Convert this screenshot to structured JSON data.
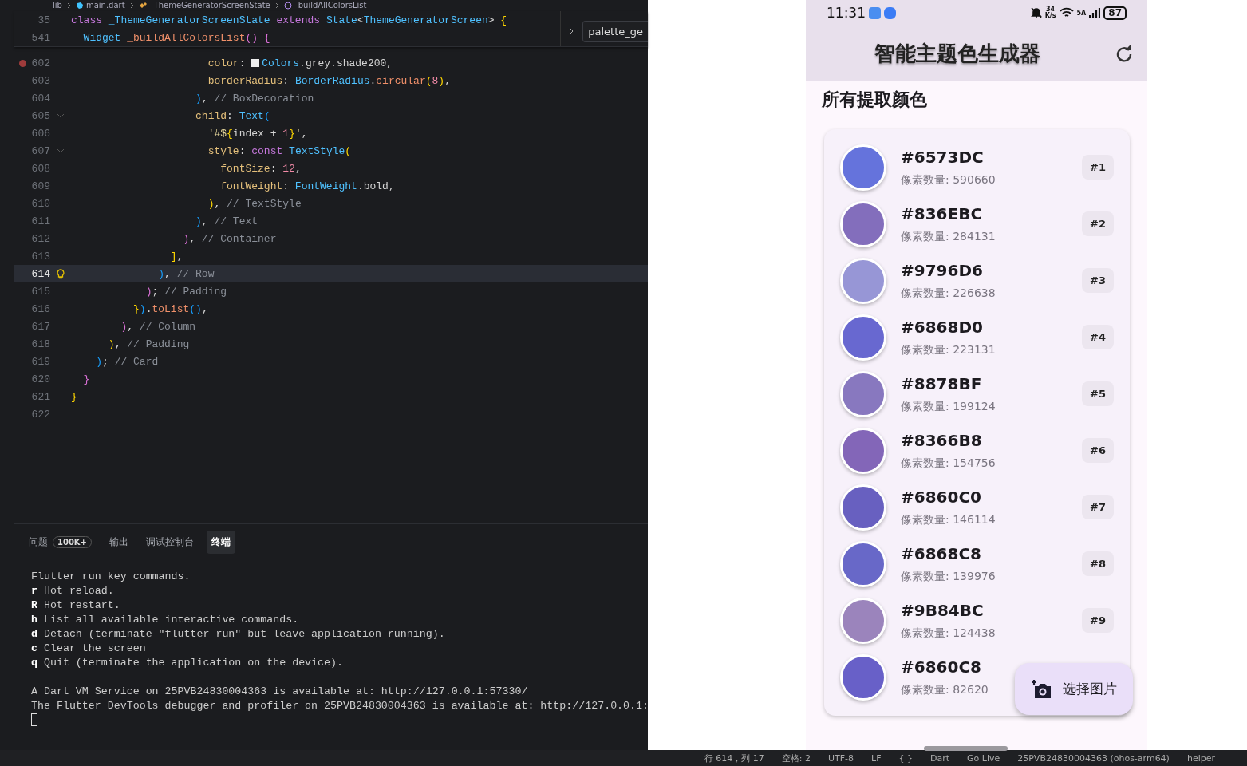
{
  "editor": {
    "breadcrumbs": [
      {
        "label": "lib",
        "kind": "folder"
      },
      {
        "label": "main.dart",
        "kind": "file"
      },
      {
        "label": "_ThemeGeneratorScreenState",
        "kind": "class"
      },
      {
        "label": "_buildAllColorsList",
        "kind": "method"
      }
    ],
    "side_tab": {
      "label": "palette_ge"
    },
    "sticky_lines": [
      {
        "number": "35",
        "tokens": [
          {
            "kind": "keyword",
            "text": "class "
          },
          {
            "kind": "type",
            "text": "_ThemeGeneratorScreenState "
          },
          {
            "kind": "keyword",
            "text": "extends "
          },
          {
            "kind": "type",
            "text": "State"
          },
          {
            "kind": "plain",
            "text": "<"
          },
          {
            "kind": "type",
            "text": "ThemeGeneratorScreen"
          },
          {
            "kind": "plain",
            "text": "> "
          },
          {
            "kind": "bracket1",
            "text": "{"
          }
        ]
      },
      {
        "number": "541",
        "tokens": [
          {
            "kind": "type",
            "text": "  Widget "
          },
          {
            "kind": "function",
            "text": "_buildAllColorsList"
          },
          {
            "kind": "bracket2",
            "text": "() {"
          }
        ]
      }
    ],
    "lines": [
      {
        "number": "602",
        "kind": "breakpoint",
        "current": false,
        "tokens": [
          {
            "kind": "property",
            "text": "                      color"
          },
          {
            "kind": "plain",
            "text": ": "
          },
          {
            "kind": "swatch",
            "color": "#eeeeee"
          },
          {
            "kind": "type",
            "text": "Colors"
          },
          {
            "kind": "plain",
            "text": ".grey.shade200,"
          }
        ]
      },
      {
        "number": "603",
        "kind": "plain",
        "current": false,
        "tokens": [
          {
            "kind": "property",
            "text": "                      borderRadius"
          },
          {
            "kind": "plain",
            "text": ": "
          },
          {
            "kind": "type",
            "text": "BorderRadius"
          },
          {
            "kind": "plain",
            "text": "."
          },
          {
            "kind": "function",
            "text": "circular"
          },
          {
            "kind": "bracket1",
            "text": "("
          },
          {
            "kind": "number",
            "text": "8"
          },
          {
            "kind": "bracket1",
            "text": ")"
          },
          {
            "kind": "plain",
            "text": ","
          }
        ]
      },
      {
        "number": "604",
        "kind": "plain",
        "current": false,
        "tokens": [
          {
            "kind": "bracket3",
            "text": "                    )"
          },
          {
            "kind": "plain",
            "text": ", "
          },
          {
            "kind": "comment",
            "text": "// BoxDecoration"
          }
        ]
      },
      {
        "number": "605",
        "kind": "fold",
        "current": false,
        "tokens": [
          {
            "kind": "property",
            "text": "                    child"
          },
          {
            "kind": "plain",
            "text": ": "
          },
          {
            "kind": "type",
            "text": "Text"
          },
          {
            "kind": "bracket3",
            "text": "("
          }
        ]
      },
      {
        "number": "606",
        "kind": "plain",
        "current": false,
        "tokens": [
          {
            "kind": "string",
            "text": "                      '#$"
          },
          {
            "kind": "bracket1",
            "text": "{"
          },
          {
            "kind": "plain",
            "text": "index + "
          },
          {
            "kind": "number",
            "text": "1"
          },
          {
            "kind": "bracket1",
            "text": "}"
          },
          {
            "kind": "string",
            "text": "'"
          },
          {
            "kind": "plain",
            "text": ","
          }
        ]
      },
      {
        "number": "607",
        "kind": "fold",
        "current": false,
        "tokens": [
          {
            "kind": "property",
            "text": "                      style"
          },
          {
            "kind": "plain",
            "text": ": "
          },
          {
            "kind": "keyword",
            "text": "const "
          },
          {
            "kind": "type",
            "text": "TextStyle"
          },
          {
            "kind": "bracket1",
            "text": "("
          }
        ]
      },
      {
        "number": "608",
        "kind": "plain",
        "current": false,
        "tokens": [
          {
            "kind": "property",
            "text": "                        fontSize"
          },
          {
            "kind": "plain",
            "text": ": "
          },
          {
            "kind": "number",
            "text": "12"
          },
          {
            "kind": "plain",
            "text": ","
          }
        ]
      },
      {
        "number": "609",
        "kind": "plain",
        "current": false,
        "tokens": [
          {
            "kind": "property",
            "text": "                        fontWeight"
          },
          {
            "kind": "plain",
            "text": ": "
          },
          {
            "kind": "type",
            "text": "FontWeight"
          },
          {
            "kind": "plain",
            "text": ".bold,"
          }
        ]
      },
      {
        "number": "610",
        "kind": "plain",
        "current": false,
        "tokens": [
          {
            "kind": "bracket1",
            "text": "                      )"
          },
          {
            "kind": "plain",
            "text": ", "
          },
          {
            "kind": "comment",
            "text": "// TextStyle"
          }
        ]
      },
      {
        "number": "611",
        "kind": "plain",
        "current": false,
        "tokens": [
          {
            "kind": "bracket3",
            "text": "                    )"
          },
          {
            "kind": "plain",
            "text": ", "
          },
          {
            "kind": "comment",
            "text": "// Text"
          }
        ]
      },
      {
        "number": "612",
        "kind": "plain",
        "current": false,
        "tokens": [
          {
            "kind": "bracket2",
            "text": "                  )"
          },
          {
            "kind": "plain",
            "text": ", "
          },
          {
            "kind": "comment",
            "text": "// Container"
          }
        ]
      },
      {
        "number": "613",
        "kind": "plain",
        "current": false,
        "tokens": [
          {
            "kind": "bracket1",
            "text": "                ]"
          },
          {
            "kind": "plain",
            "text": ","
          }
        ]
      },
      {
        "number": "614",
        "kind": "bulb",
        "current": true,
        "tokens": [
          {
            "kind": "bracket3",
            "text": "              )"
          },
          {
            "kind": "plain",
            "text": ", "
          },
          {
            "kind": "comment",
            "text": "// Row"
          }
        ]
      },
      {
        "number": "615",
        "kind": "plain",
        "current": false,
        "tokens": [
          {
            "kind": "bracket2",
            "text": "            )"
          },
          {
            "kind": "plain",
            "text": "; "
          },
          {
            "kind": "comment",
            "text": "// Padding"
          }
        ]
      },
      {
        "number": "616",
        "kind": "plain",
        "current": false,
        "tokens": [
          {
            "kind": "bracket1",
            "text": "          }"
          },
          {
            "kind": "bracket3",
            "text": ")"
          },
          {
            "kind": "plain",
            "text": "."
          },
          {
            "kind": "function",
            "text": "toList"
          },
          {
            "kind": "bracket3",
            "text": "()"
          },
          {
            "kind": "plain",
            "text": ","
          }
        ]
      },
      {
        "number": "617",
        "kind": "plain",
        "current": false,
        "tokens": [
          {
            "kind": "bracket2",
            "text": "        )"
          },
          {
            "kind": "plain",
            "text": ", "
          },
          {
            "kind": "comment",
            "text": "// Column"
          }
        ]
      },
      {
        "number": "618",
        "kind": "plain",
        "current": false,
        "tokens": [
          {
            "kind": "bracket1",
            "text": "      )"
          },
          {
            "kind": "plain",
            "text": ", "
          },
          {
            "kind": "comment",
            "text": "// Padding"
          }
        ]
      },
      {
        "number": "619",
        "kind": "plain",
        "current": false,
        "tokens": [
          {
            "kind": "bracket3",
            "text": "    )"
          },
          {
            "kind": "plain",
            "text": "; "
          },
          {
            "kind": "comment",
            "text": "// Card"
          }
        ]
      },
      {
        "number": "620",
        "kind": "plain",
        "current": false,
        "tokens": [
          {
            "kind": "bracket2",
            "text": "  }"
          }
        ]
      },
      {
        "number": "621",
        "kind": "plain",
        "current": false,
        "tokens": [
          {
            "kind": "bracket1",
            "text": "}"
          }
        ]
      },
      {
        "number": "622",
        "kind": "plain",
        "current": false
      }
    ]
  },
  "panel": {
    "tabs": [
      {
        "label": "问题",
        "badge": "100K+",
        "selected": false
      },
      {
        "label": "输出",
        "selected": false
      },
      {
        "label": "调试控制台",
        "selected": false
      },
      {
        "label": "终端",
        "selected": true
      }
    ],
    "terminal_blocks": [
      [
        "Flutter run key commands.",
        "**r** Hot reload.",
        "**R** Hot restart.",
        "**h** List all available interactive commands.",
        "**d** Detach (terminate \"flutter run\" but leave application running).",
        "**c** Clear the screen",
        "**q** Quit (terminate the application on the device)."
      ],
      [
        "A Dart VM Service on 25PVB24830004363 is available at: http://127.0.0.1:57330/",
        "The Flutter DevTools debugger and profiler on 25PVB24830004363 is available at: http://127.0.0.1:"
      ]
    ]
  },
  "status_bar": {
    "items": [
      "行 614，列 17",
      "空格: 2",
      "UTF-8",
      "LF",
      "{ }",
      "Dart",
      "Go Live",
      "25PVB24830004363 (ohos-arm64)",
      "helper"
    ]
  },
  "phone": {
    "status": {
      "time": "11:31",
      "net_speed": "34",
      "net_unit": "K/s",
      "signal_label": "5A",
      "battery": "87"
    },
    "app_bar": {
      "title": "智能主题色生成器"
    },
    "section_title": "所有提取颜色",
    "colors": [
      {
        "hex": "#6573DC",
        "count": "像素数量: 590660",
        "rank": "#1",
        "color": "#6573dc"
      },
      {
        "hex": "#836EBC",
        "count": "像素数量: 284131",
        "rank": "#2",
        "color": "#836ebc"
      },
      {
        "hex": "#9796D6",
        "count": "像素数量: 226638",
        "rank": "#3",
        "color": "#9796d6"
      },
      {
        "hex": "#6868D0",
        "count": "像素数量: 223131",
        "rank": "#4",
        "color": "#6868d0"
      },
      {
        "hex": "#8878BF",
        "count": "像素数量: 199124",
        "rank": "#5",
        "color": "#8878bf"
      },
      {
        "hex": "#8366B8",
        "count": "像素数量: 154756",
        "rank": "#6",
        "color": "#8366b8"
      },
      {
        "hex": "#6860C0",
        "count": "像素数量: 146114",
        "rank": "#7",
        "color": "#6860c0"
      },
      {
        "hex": "#6868C8",
        "count": "像素数量: 139976",
        "rank": "#8",
        "color": "#6868c8"
      },
      {
        "hex": "#9B84BC",
        "count": "像素数量: 124438",
        "rank": "#9",
        "color": "#9b84bc"
      },
      {
        "hex": "#6860C8",
        "count": "像素数量: 82620",
        "color": "#6860c8"
      }
    ],
    "fab": {
      "label": "选择图片"
    }
  }
}
